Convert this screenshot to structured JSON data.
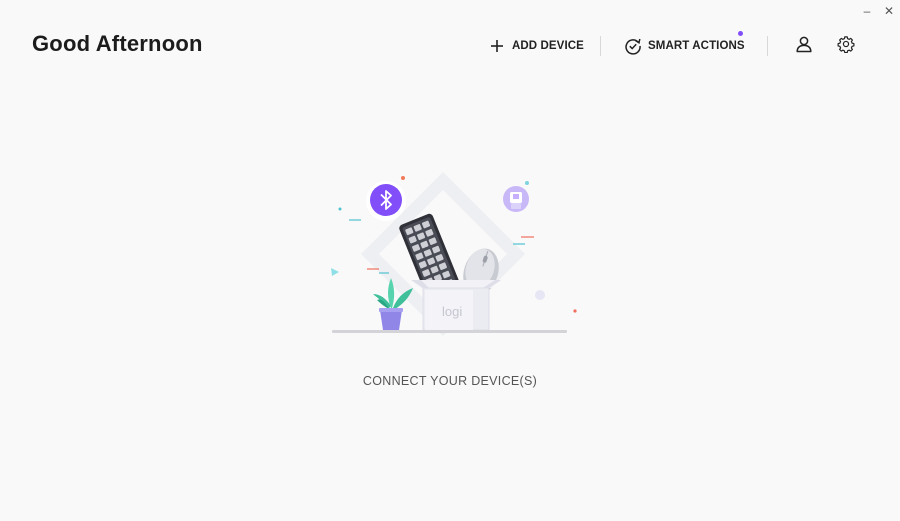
{
  "window": {
    "minimize_glyph": "–",
    "close_glyph": "✕"
  },
  "header": {
    "greeting": "Good Afternoon",
    "add_device_label": "ADD DEVICE",
    "smart_actions_label": "SMART ACTIONS",
    "smart_actions_badge_color": "#814efa",
    "icons": {
      "add": "plus-icon",
      "smart_actions": "refresh-check-icon",
      "profile": "user-icon",
      "settings": "gear-icon"
    }
  },
  "main": {
    "illustration": {
      "box_brand": "logi",
      "bluetooth_color": "#814efa",
      "receiver_color": "#c9b8f7"
    },
    "connect_label": "CONNECT YOUR DEVICE(S)"
  }
}
